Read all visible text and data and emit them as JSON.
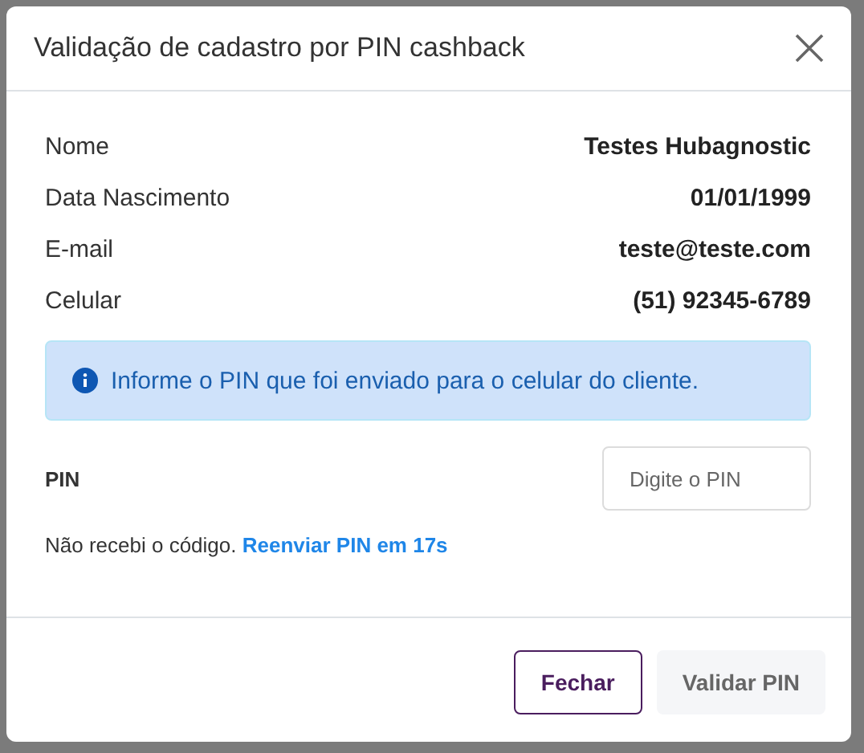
{
  "dialog": {
    "title": "Validação de cadastro por PIN cashback"
  },
  "fields": [
    {
      "label": "Nome",
      "value": "Testes Hubagnostic"
    },
    {
      "label": "Data Nascimento",
      "value": "01/01/1999"
    },
    {
      "label": "E-mail",
      "value": "teste@teste.com"
    },
    {
      "label": "Celular",
      "value": "(51) 92345-6789"
    }
  ],
  "alert": {
    "text": "Informe o PIN que foi enviado para o celular do cliente."
  },
  "pin": {
    "label": "PIN",
    "placeholder": "Digite o PIN"
  },
  "resend": {
    "text": "Não recebi o código.",
    "link": "Reenviar PIN em 17s"
  },
  "buttons": [
    {
      "label": "Fechar",
      "kind": "outline",
      "disabled": false
    },
    {
      "label": "Validar PIN",
      "kind": "primary",
      "disabled": true
    }
  ]
}
